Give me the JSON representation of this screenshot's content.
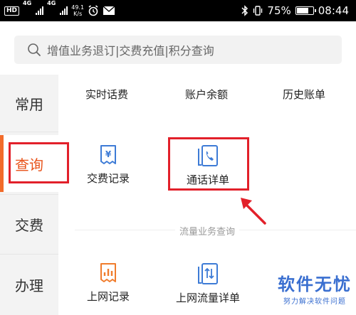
{
  "status_bar": {
    "network_badge": "HD",
    "signal1_gen": "4G",
    "signal2_gen": "4G",
    "speed_value": "49.1",
    "speed_unit": "K/s",
    "battery_text": "75%",
    "battery_level": 0.75,
    "time": "08:44"
  },
  "search": {
    "placeholder": "增值业务退订|交费充值|积分查询"
  },
  "sidebar": {
    "items": [
      {
        "label": "常用"
      },
      {
        "label": "查询"
      },
      {
        "label": "交费"
      },
      {
        "label": "办理"
      }
    ],
    "active_index": 1
  },
  "query": {
    "top_links": [
      "实时话费",
      "账户余额",
      "历史账单"
    ],
    "tiles": [
      {
        "label": "交费记录",
        "icon": "receipt-yen-icon"
      },
      {
        "label": "通话详单",
        "icon": "call-detail-icon"
      }
    ]
  },
  "traffic": {
    "section_title": "流量业务查询",
    "tiles": [
      {
        "label": "上网记录",
        "icon": "data-record-icon"
      },
      {
        "label": "上网流量详单",
        "icon": "data-detail-icon"
      }
    ]
  },
  "watermark": {
    "title": "软件无忧",
    "subtitle": "努力解决软件问题"
  },
  "colors": {
    "accent": "#e8531a",
    "highlight": "#e2202a",
    "icon_blue": "#3d7bd6",
    "icon_orange": "#f07c2c"
  }
}
